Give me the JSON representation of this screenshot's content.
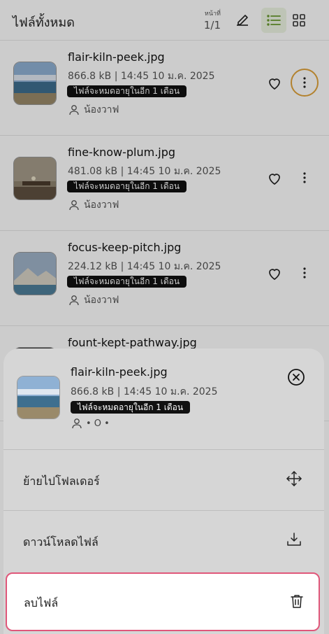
{
  "header": {
    "title": "ไฟล์ทั้งหมด",
    "page_label": "หน้าที่",
    "page_value": "1/1",
    "edit_icon": "pencil-icon",
    "list_view_icon": "list-icon",
    "grid_view_icon": "grid-icon"
  },
  "files": [
    {
      "name": "flair-kiln-peek.jpg",
      "meta": "866.8 kB | 14:45 10 ม.ค. 2025",
      "expiry": "ไฟล์จะหมดอายุในอีก 1 เดือน",
      "owner": "น้องวาฟ"
    },
    {
      "name": "fine-know-plum.jpg",
      "meta": "481.08 kB | 14:45 10 ม.ค. 2025",
      "expiry": "ไฟล์จะหมดอายุในอีก 1 เดือน",
      "owner": "น้องวาฟ"
    },
    {
      "name": "focus-keep-pitch.jpg",
      "meta": "224.12 kB | 14:45 10 ม.ค. 2025",
      "expiry": "ไฟล์จะหมดอายุในอีก 1 เดือน",
      "owner": "น้องวาฟ"
    },
    {
      "name": "fount-kept-pathway.jpg"
    }
  ],
  "sheet": {
    "file_name": "flair-kiln-peek.jpg",
    "file_meta": "866.8 kB | 14:45 10 ม.ค. 2025",
    "expiry": "ไฟล์จะหมดอายุในอีก 1 เดือน",
    "owner_text": "• O •",
    "actions": [
      {
        "label": "ย้ายไปโฟลเดอร์",
        "icon": "move-icon"
      },
      {
        "label": "ดาวน์โหลดไฟล์",
        "icon": "download-icon"
      },
      {
        "label": "ลบไฟล์",
        "icon": "trash-icon"
      }
    ]
  },
  "colors": {
    "accent_green": "#6a9a2e",
    "focus_ring": "#e0a33a",
    "danger_border": "#e0577a",
    "badge_bg": "#111111"
  }
}
